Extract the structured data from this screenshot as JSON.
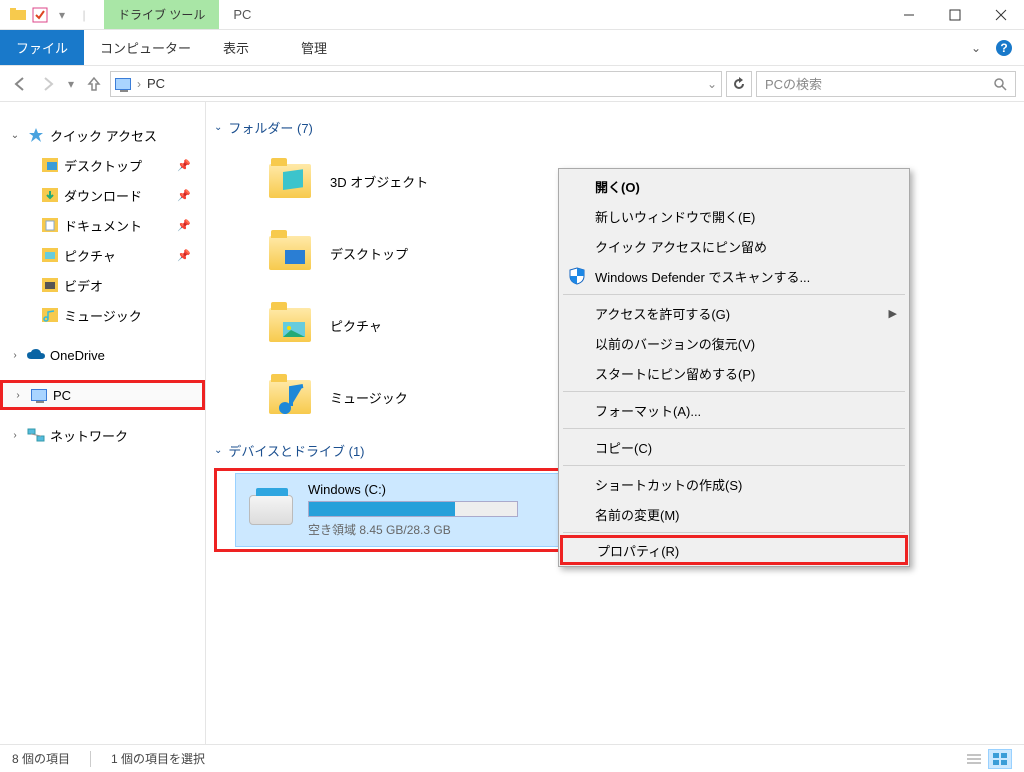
{
  "titlebar": {
    "tools_tab": "ドライブ ツール",
    "window_title": "PC"
  },
  "ribbon": {
    "file": "ファイル",
    "computer": "コンピューター",
    "view": "表示",
    "manage": "管理"
  },
  "navbar": {
    "location": "PC",
    "search_placeholder": "PCの検索"
  },
  "sidebar": {
    "quick_access": "クイック アクセス",
    "desktop": "デスクトップ",
    "downloads": "ダウンロード",
    "documents": "ドキュメント",
    "pictures": "ピクチャ",
    "videos": "ビデオ",
    "music": "ミュージック",
    "onedrive": "OneDrive",
    "pc": "PC",
    "network": "ネットワーク"
  },
  "content": {
    "folders_header": "フォルダー (7)",
    "drives_header": "デバイスとドライブ (1)",
    "folders": {
      "objects3d": "3D オブジェクト",
      "desktop": "デスクトップ",
      "pictures": "ピクチャ",
      "music": "ミュージック"
    },
    "drive": {
      "name": "Windows (C:)",
      "space": "空き領域 8.45 GB/28.3 GB",
      "fill_percent": 70
    }
  },
  "context_menu": {
    "open": "開く(O)",
    "open_new_window": "新しいウィンドウで開く(E)",
    "pin_quick": "クイック アクセスにピン留め",
    "defender": "Windows Defender でスキャンする...",
    "give_access": "アクセスを許可する(G)",
    "restore_versions": "以前のバージョンの復元(V)",
    "pin_start": "スタートにピン留めする(P)",
    "format": "フォーマット(A)...",
    "copy": "コピー(C)",
    "create_shortcut": "ショートカットの作成(S)",
    "rename": "名前の変更(M)",
    "properties": "プロパティ(R)"
  },
  "statusbar": {
    "item_count": "8 個の項目",
    "selection": "1 個の項目を選択"
  }
}
